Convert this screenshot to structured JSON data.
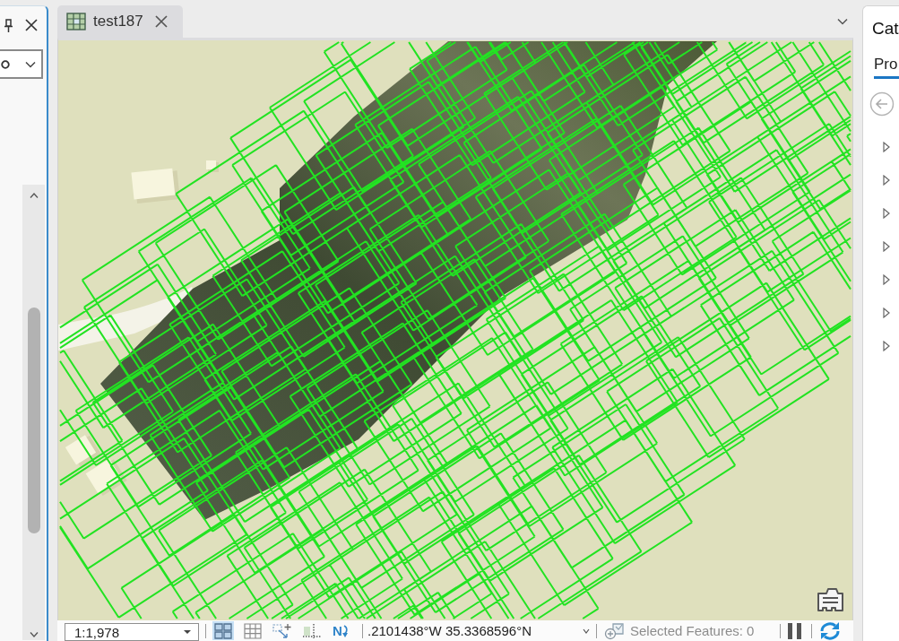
{
  "map_tabs": [
    {
      "label": "test187",
      "selected": true
    }
  ],
  "status_bar": {
    "scale": "1:1,978",
    "tools": [
      {
        "kind": "tiles",
        "selected": true
      },
      {
        "kind": "grid",
        "selected": false
      },
      {
        "kind": "snap",
        "selected": false
      },
      {
        "kind": "guides",
        "selected": false
      },
      {
        "kind": "north",
        "label": "N",
        "selected": false
      }
    ],
    "coordinates": ".2101438°W 35.3368596°N",
    "selected_features": "Selected Features: 0"
  },
  "catalog": {
    "title": "Cat",
    "tabs": [
      {
        "label": "Pro",
        "selected": true
      }
    ],
    "items": [
      {
        "expanded": false
      },
      {
        "expanded": false
      },
      {
        "expanded": false
      },
      {
        "expanded": false
      },
      {
        "expanded": false
      },
      {
        "expanded": false
      },
      {
        "expanded": false
      }
    ]
  }
}
